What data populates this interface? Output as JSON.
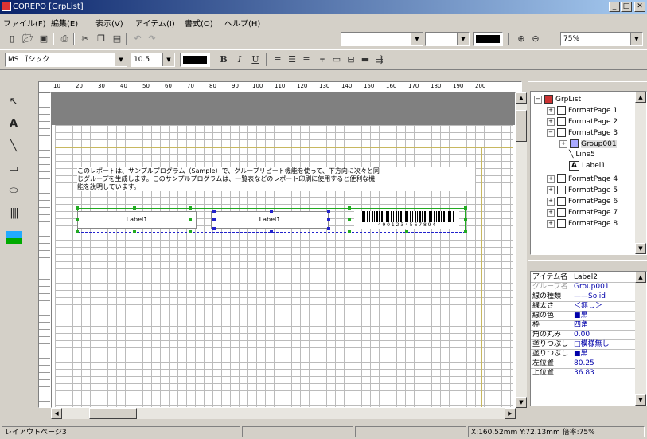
{
  "window": {
    "title": "COREPO [GrpList]",
    "min": "_",
    "max": "□",
    "close": "✕"
  },
  "menu": [
    "ファイル(F)",
    "編集(E)",
    "表示(V)",
    "アイテム(I)",
    "書式(O)",
    "ヘルプ(H)"
  ],
  "toolbar": {
    "zoom_value": "75%",
    "font_name": "MS ゴシック",
    "font_size": "10.5",
    "bold": "B",
    "italic": "I",
    "underline": "U"
  },
  "tools": [
    "pointer-icon",
    "text-icon",
    "line-icon",
    "rectangle-icon",
    "ellipse-icon",
    "barcode-icon",
    "image-icon"
  ],
  "ruler": {
    "ticks": [
      "10",
      "20",
      "30",
      "40",
      "50",
      "60",
      "70",
      "80",
      "90",
      "100",
      "110",
      "120",
      "130",
      "140",
      "150",
      "160",
      "170",
      "180",
      "190",
      "200"
    ]
  },
  "canvas": {
    "text_line1": "このレポートは、サンプルプログラム（Sample）で、グループリピート機能を使って、下方向に次々と同",
    "text_line2": "じグループを生成します。このサンプルプログラムは、一覧表などのレポート印刷に使用すると便利な機",
    "text_line3": "能を説明しています。",
    "label1": "Label1",
    "label2": "Label1",
    "barcode_text": "4 9 0 1 2 3 4 5 6 7 8 9 4"
  },
  "tree": {
    "root": "GrpList",
    "items": [
      {
        "label": "FormatPage 1",
        "indent": 1,
        "exp": "+"
      },
      {
        "label": "FormatPage 2",
        "indent": 1,
        "exp": "+"
      },
      {
        "label": "FormatPage 3",
        "indent": 1,
        "exp": "-"
      },
      {
        "label": "Group001",
        "indent": 2,
        "exp": "+"
      },
      {
        "label": "Line5",
        "indent": 2,
        "exp": ""
      },
      {
        "label": "Label1",
        "indent": 2,
        "exp": ""
      },
      {
        "label": "FormatPage 4",
        "indent": 1,
        "exp": "+"
      },
      {
        "label": "FormatPage 5",
        "indent": 1,
        "exp": "+"
      },
      {
        "label": "FormatPage 6",
        "indent": 1,
        "exp": "+"
      },
      {
        "label": "FormatPage 7",
        "indent": 1,
        "exp": "+"
      },
      {
        "label": "FormatPage 8",
        "indent": 1,
        "exp": "+"
      }
    ]
  },
  "props": [
    {
      "k": "アイテム名",
      "v": "Label2"
    },
    {
      "k": "グループ名",
      "v": "Group001"
    },
    {
      "k": "線の種類",
      "v": "——Solid"
    },
    {
      "k": "線太さ",
      "v": "＜無し＞"
    },
    {
      "k": "線の色",
      "v": "■黒"
    },
    {
      "k": "枠",
      "v": "四角"
    },
    {
      "k": "角の丸み",
      "v": "0.00"
    },
    {
      "k": "塗りつぶし",
      "v": "□模様無し"
    },
    {
      "k": "塗りつぶし",
      "v": "■黒"
    },
    {
      "k": "左位置",
      "v": "80.25"
    },
    {
      "k": "上位置",
      "v": "36.83"
    }
  ],
  "status": {
    "page": "レイアウトページ3",
    "coords": "X:160.52mm Y:72.13mm 倍率:75%"
  }
}
